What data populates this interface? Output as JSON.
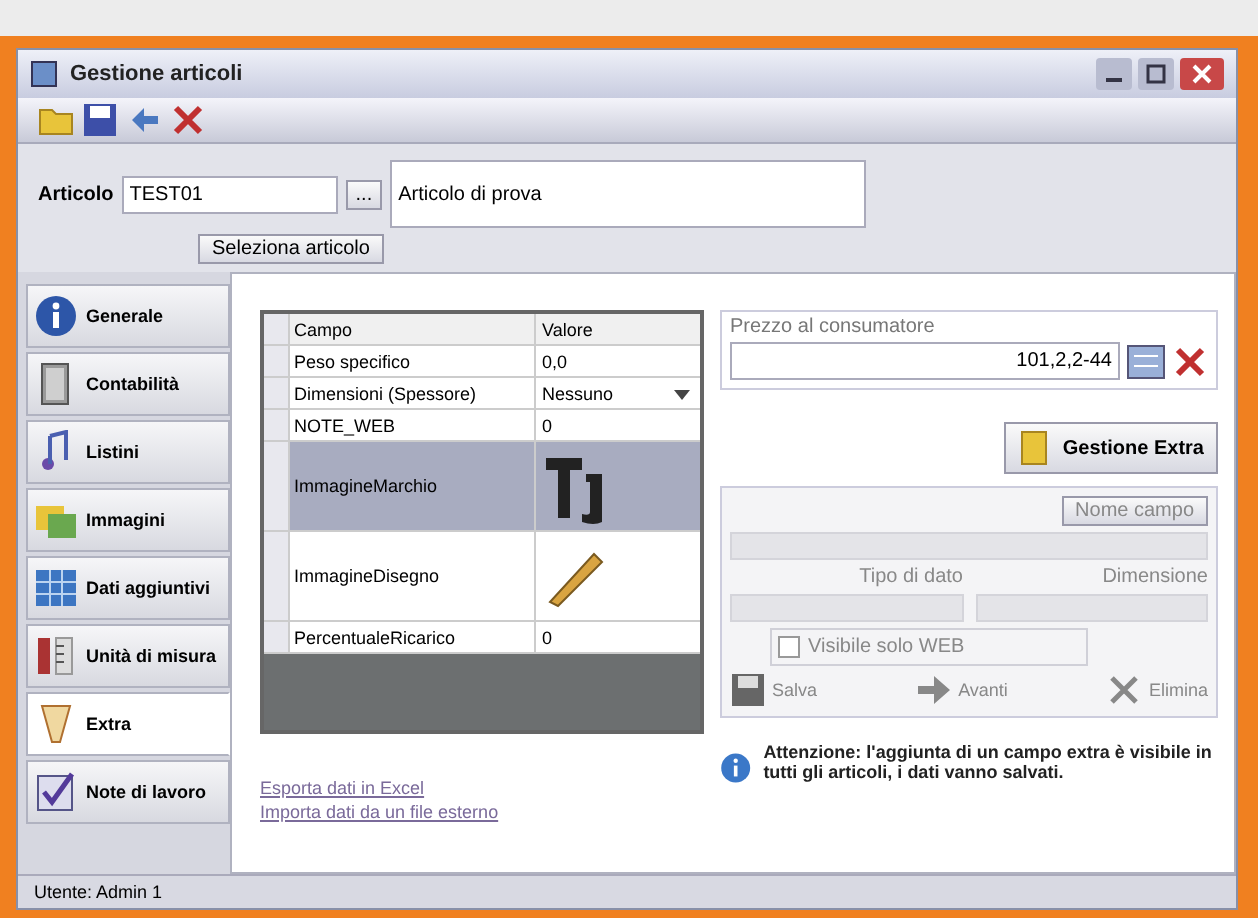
{
  "window": {
    "title": "Gestione articoli"
  },
  "toolbar": {
    "buttons": [
      {
        "kind": "new"
      },
      {
        "kind": "save"
      },
      {
        "kind": "undo"
      },
      {
        "kind": "delete"
      }
    ]
  },
  "header": {
    "code_label": "Articolo",
    "code_value": "TEST01",
    "browse_button": "...",
    "description": "Articolo di prova",
    "select_button": "Seleziona articolo"
  },
  "sidebar": {
    "items": [
      {
        "label": "Generale",
        "kind": "info",
        "selected": false
      },
      {
        "label": "Contabilità",
        "kind": "doc",
        "selected": false
      },
      {
        "label": "Listini",
        "kind": "note",
        "selected": false
      },
      {
        "label": "Immagini",
        "kind": "image",
        "selected": false
      },
      {
        "label": "Dati aggiuntivi",
        "kind": "grid",
        "selected": false
      },
      {
        "label": "Unità di misura",
        "kind": "units",
        "selected": false
      },
      {
        "label": "Extra",
        "kind": "extra",
        "selected": true
      },
      {
        "label": "Note di lavoro",
        "kind": "check",
        "selected": false
      }
    ]
  },
  "grid": {
    "columns": [
      "Campo",
      "Valore"
    ],
    "rows": [
      {
        "kind": "text",
        "field": "Peso specifico",
        "value": "0,0"
      },
      {
        "kind": "combo",
        "field": "Dimensioni (Spessore)",
        "value": "Nessuno"
      },
      {
        "kind": "text",
        "field": "NOTE_WEB",
        "value": "0"
      },
      {
        "kind": "letters",
        "field": "ImmagineMarchio",
        "selected": true
      },
      {
        "kind": "pencil",
        "field": "ImmagineDisegno",
        "selected": false
      },
      {
        "kind": "text",
        "field": "PercentualeRicarico",
        "value": "0"
      }
    ]
  },
  "links": [
    "Esporta dati in Excel",
    "Importa dati da un file esterno"
  ],
  "price_group": {
    "title": "Prezzo al consumatore",
    "value": "101,2,2-44"
  },
  "extra_button": "Gestione Extra",
  "editor": {
    "name_button": "Nome campo",
    "type_label": "Tipo di dato",
    "size_label": "Dimensione",
    "visible_label": "Visibile solo WEB",
    "visible_checked": false,
    "buttons": [
      {
        "kind": "save",
        "label": "Salva"
      },
      {
        "kind": "next",
        "label": "Avanti"
      },
      {
        "kind": "delete",
        "label": "Elimina"
      }
    ]
  },
  "info_text": "Attenzione: l'aggiunta di un campo extra è visibile in tutti gli articoli, i dati vanno salvati.",
  "status_bar": "Utente: Admin 1"
}
